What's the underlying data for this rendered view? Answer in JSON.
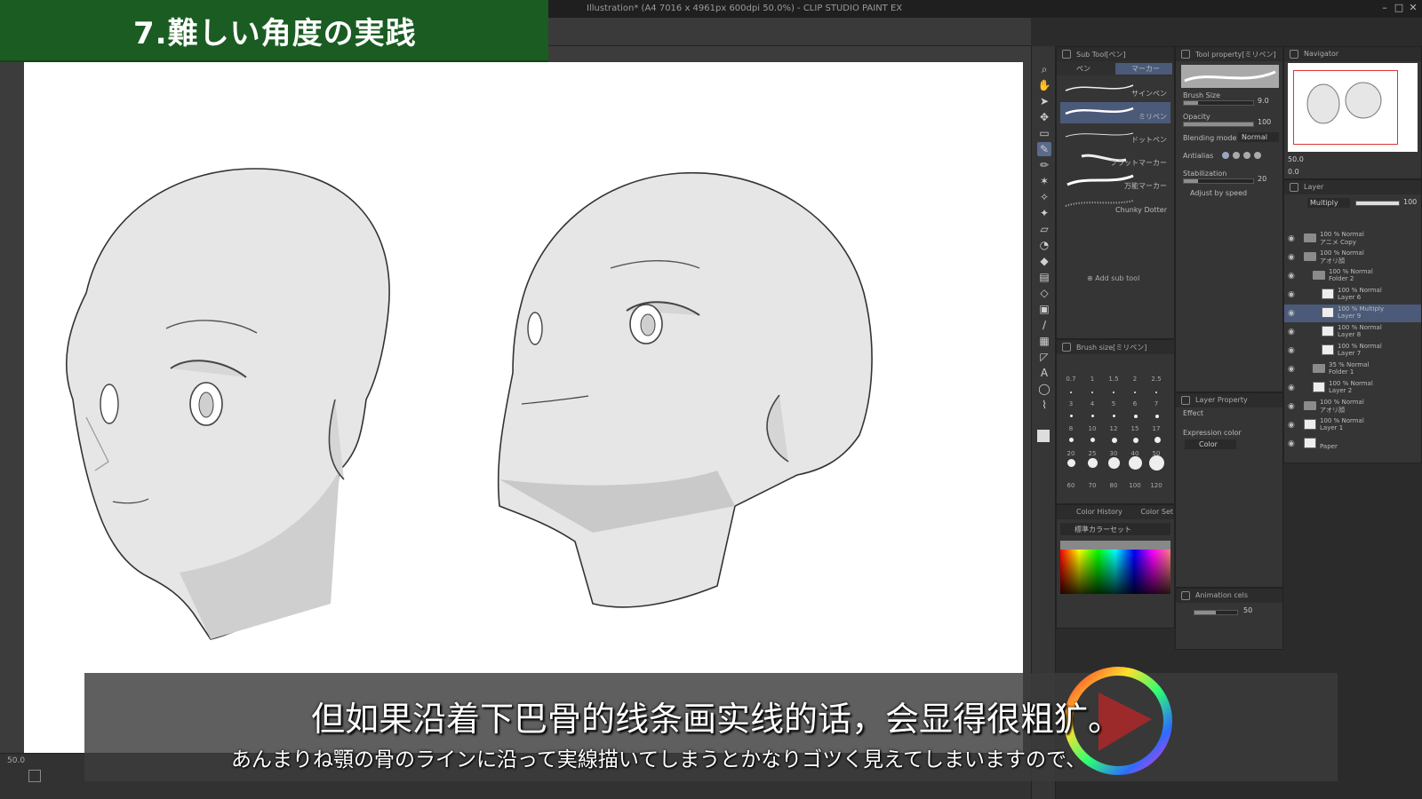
{
  "window": {
    "title": "Illustration* (A4 7016 x 4961px 600dpi 50.0%)  - CLIP STUDIO PAINT EX",
    "controls": [
      "–",
      "□",
      "✕"
    ]
  },
  "banner": {
    "text": "7.難しい角度の実践"
  },
  "status": {
    "zoom": "50.0"
  },
  "subtool_panel": {
    "header": "Sub Tool[ペン]",
    "tabs": [
      "ペン",
      "マーカー"
    ],
    "brushes": [
      "サインペン",
      "ミリペン",
      "ドットペン",
      "フラットマーカー",
      "万能マーカー",
      "Chunky Dotter"
    ],
    "add_label": "Add sub tool"
  },
  "tool_property": {
    "header": "Tool property[ミリペン]",
    "brush_size_label": "Brush Size",
    "brush_size_value": "9.0",
    "opacity_label": "Opacity",
    "opacity_value": "100",
    "blending_label": "Blending mode",
    "blending_value": "Normal",
    "antialias_label": "Antialias",
    "stabilization_label": "Stabilization",
    "stabilization_value": "20",
    "adjust_label": "Adjust by speed"
  },
  "brush_size_panel": {
    "header": "Brush size[ミリペン]",
    "sizes": [
      "0.7",
      "1",
      "1.5",
      "2",
      "2.5",
      "3",
      "4",
      "5",
      "6",
      "7",
      "8",
      "10",
      "12",
      "15",
      "17",
      "20",
      "25",
      "30",
      "40",
      "50",
      "60",
      "70",
      "80",
      "100",
      "120"
    ]
  },
  "layer_property": {
    "header": "Layer Property",
    "effect_label": "Effect",
    "expression_label": "Expression color",
    "expression_value": "Color"
  },
  "color_panel": {
    "tabs": [
      "Color History",
      "Color Set"
    ],
    "set_name": "標準カラーセット"
  },
  "animation_panel": {
    "header": "Animation cels",
    "value": "50"
  },
  "navigator": {
    "header": "Navigator",
    "zoom": "50.0",
    "angle": "0.0"
  },
  "layer_panel": {
    "header": "Layer",
    "blend": "Multiply",
    "opacity": "100",
    "layers": [
      {
        "l1": "100 % Normal",
        "l2": "アニメ Copy",
        "kind": "folder",
        "indent": 0,
        "sel": false
      },
      {
        "l1": "100 % Normal",
        "l2": "アオリ顔",
        "kind": "folder",
        "indent": 0,
        "sel": false
      },
      {
        "l1": "100 % Normal",
        "l2": "Folder 2",
        "kind": "folder",
        "indent": 1,
        "sel": false
      },
      {
        "l1": "100 % Normal",
        "l2": "Layer 6",
        "kind": "layer",
        "indent": 2,
        "sel": false
      },
      {
        "l1": "100 % Multiply",
        "l2": "Layer 9",
        "kind": "layer",
        "indent": 2,
        "sel": true
      },
      {
        "l1": "100 % Normal",
        "l2": "Layer 8",
        "kind": "layer",
        "indent": 2,
        "sel": false
      },
      {
        "l1": "100 % Normal",
        "l2": "Layer 7",
        "kind": "layer",
        "indent": 2,
        "sel": false
      },
      {
        "l1": "35 % Normal",
        "l2": "Folder 1",
        "kind": "folder",
        "indent": 1,
        "sel": false
      },
      {
        "l1": "100 % Normal",
        "l2": "Layer 2",
        "kind": "layer",
        "indent": 1,
        "sel": false
      },
      {
        "l1": "100 % Normal",
        "l2": "アオリ顔",
        "kind": "folder",
        "indent": 0,
        "sel": false
      },
      {
        "l1": "100 % Normal",
        "l2": "Layer 1",
        "kind": "layer",
        "indent": 0,
        "sel": false
      },
      {
        "l1": "",
        "l2": "Paper",
        "kind": "paper",
        "indent": 0,
        "sel": false
      }
    ]
  },
  "subtitles": {
    "cn": "但如果沿着下巴骨的线条画实线的话，会显得很粗犷。",
    "jp": "あんまりね顎の骨のラインに沿って実線描いてしまうとかなりゴツく見えてしまいますので、"
  },
  "colors": {
    "banner": "#1a5c22",
    "accent": "#4a5a78",
    "panel": "#353535"
  }
}
